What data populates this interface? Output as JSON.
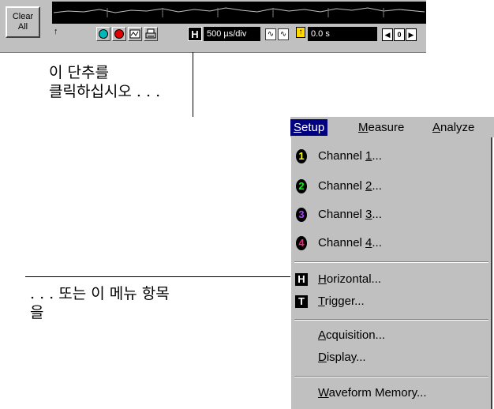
{
  "toolbar": {
    "clear_all_label": "Clear\nAll",
    "timebase_value": "500 µs/div",
    "delay_value": "0.0 s",
    "h_badge": "H",
    "nav_prev": "◀",
    "nav_zero": "0",
    "nav_next": "▶",
    "colors": {
      "cyan": "#00b8b8",
      "red": "#e00000",
      "trace": "#c0c0c0"
    },
    "icons": [
      "up-arrow-icon",
      "cyan-circle-icon",
      "red-circle-icon",
      "waveform-icon",
      "printer-icon",
      "warning-icon"
    ]
  },
  "callout_button": "이 단추를\n클릭하십시오 . . .",
  "callout_menu": ". . . 또는 이 메뉴 항목\n을",
  "menubar": {
    "setup_prefix": "S",
    "setup_rest": "etup",
    "measure_prefix": "M",
    "measure_rest": "easure",
    "analyze_prefix": "A",
    "analyze_rest": "nalyze"
  },
  "menu": {
    "channels": [
      {
        "num": "1",
        "prefix": "Channel ",
        "key": "1",
        "suffix": "...",
        "color": "#ffff00"
      },
      {
        "num": "2",
        "prefix": "Channel ",
        "key": "2",
        "suffix": "...",
        "color": "#00ff00"
      },
      {
        "num": "3",
        "prefix": "Channel ",
        "key": "3",
        "suffix": "...",
        "color": "#b040ff"
      },
      {
        "num": "4",
        "prefix": "Channel ",
        "key": "4",
        "suffix": "...",
        "color": "#ff2080"
      }
    ],
    "horizontal": {
      "badge": "H",
      "key": "H",
      "rest": "orizontal..."
    },
    "trigger": {
      "badge": "T",
      "key": "T",
      "rest": "rigger..."
    },
    "acquisition": {
      "key": "A",
      "rest": "cquisition..."
    },
    "display": {
      "key": "D",
      "rest": "isplay..."
    },
    "waveform_memory": {
      "key": "W",
      "rest": "aveform Memory..."
    }
  }
}
